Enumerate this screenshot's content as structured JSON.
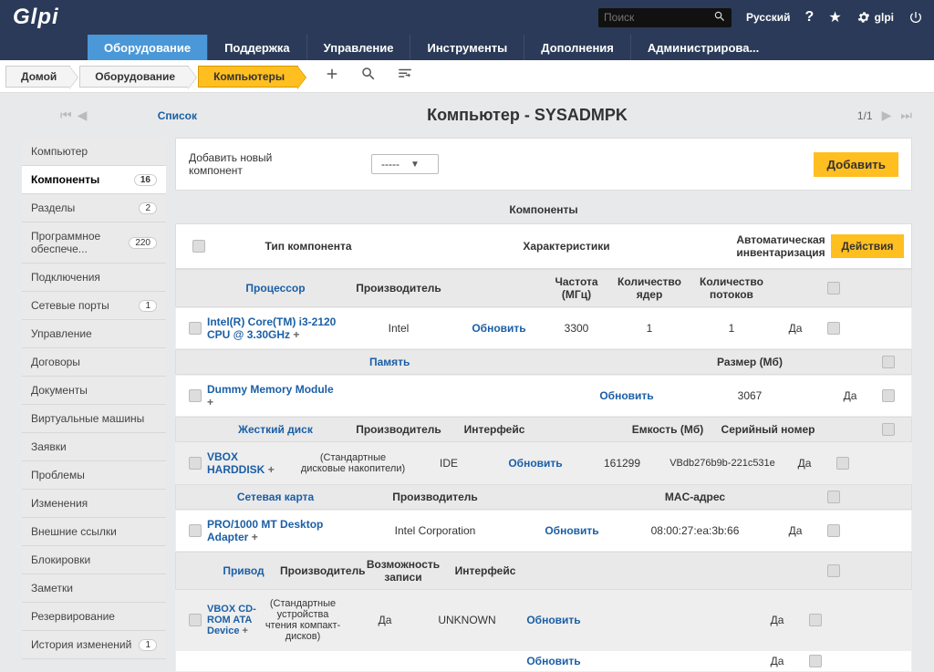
{
  "top": {
    "search_placeholder": "Поиск",
    "lang": "Русский",
    "user": "glpi"
  },
  "nav": {
    "items": [
      "Оборудование",
      "Поддержка",
      "Управление",
      "Инструменты",
      "Дополнения",
      "Администрирова..."
    ],
    "active_index": 0
  },
  "breadcrumb": {
    "items": [
      "Домой",
      "Оборудование",
      "Компьютеры"
    ],
    "active_index": 2
  },
  "page": {
    "list_link": "Список",
    "title": "Компьютер - SYSADMPK",
    "pager": "1/1"
  },
  "sidebar": {
    "items": [
      {
        "label": "Компьютер"
      },
      {
        "label": "Компоненты",
        "badge": "16",
        "active": true
      },
      {
        "label": "Разделы",
        "badge": "2"
      },
      {
        "label": "Программное обеспече...",
        "badge": "220"
      },
      {
        "label": "Подключения"
      },
      {
        "label": "Сетевые порты",
        "badge": "1"
      },
      {
        "label": "Управление"
      },
      {
        "label": "Договоры"
      },
      {
        "label": "Документы"
      },
      {
        "label": "Виртуальные машины"
      },
      {
        "label": "Заявки"
      },
      {
        "label": "Проблемы"
      },
      {
        "label": "Изменения"
      },
      {
        "label": "Внешние ссылки"
      },
      {
        "label": "Блокировки"
      },
      {
        "label": "Заметки"
      },
      {
        "label": "Резервирование"
      },
      {
        "label": "История изменений",
        "badge": "1"
      }
    ]
  },
  "add": {
    "label": "Добавить новый компонент",
    "select_value": "-----",
    "button": "Добавить"
  },
  "table": {
    "title": "Компоненты",
    "headers": {
      "type": "Тип компонента",
      "chars": "Характеристики",
      "auto": "Автоматическая инвентаризация",
      "actions": "Действия"
    },
    "yes": "Да",
    "update": "Обновить",
    "sections": {
      "processor": {
        "name": "Процессор",
        "cols": [
          "Производитель",
          "Частота (МГц)",
          "Количество ядер",
          "Количество потоков"
        ],
        "row": {
          "name": "Intel(R) Core(TM) i3-2120 CPU @ 3.30GHz",
          "manufacturer": "Intel",
          "freq": "3300",
          "cores": "1",
          "threads": "1"
        }
      },
      "memory": {
        "name": "Память",
        "cols": [
          "Размер (Мб)"
        ],
        "row": {
          "name": "Dummy Memory Module",
          "size": "3067"
        }
      },
      "hdd": {
        "name": "Жесткий диск",
        "cols": [
          "Производитель",
          "Интерфейс",
          "Емкость (Мб)",
          "Серийный номер"
        ],
        "row": {
          "name": "VBOX HARDDISK",
          "manufacturer": "(Стандартные дисковые накопители)",
          "interface": "IDE",
          "capacity": "161299",
          "serial": "VBdb276b9b-221c531e"
        }
      },
      "network": {
        "name": "Сетевая карта",
        "cols": [
          "Производитель",
          "MAC-адрес"
        ],
        "row": {
          "name": "PRO/1000 MT Desktop Adapter",
          "manufacturer": "Intel Corporation",
          "mac": "08:00:27:ea:3b:66"
        }
      },
      "drive": {
        "name": "Привод",
        "cols": [
          "Производитель",
          "Возможность записи",
          "Интерфейс"
        ],
        "row": {
          "name": "VBOX CD-ROM ATA Device",
          "manufacturer": "(Стандартные устройства чтения компакт-дисков)",
          "writable": "Да",
          "interface": "UNKNOWN"
        }
      }
    }
  }
}
